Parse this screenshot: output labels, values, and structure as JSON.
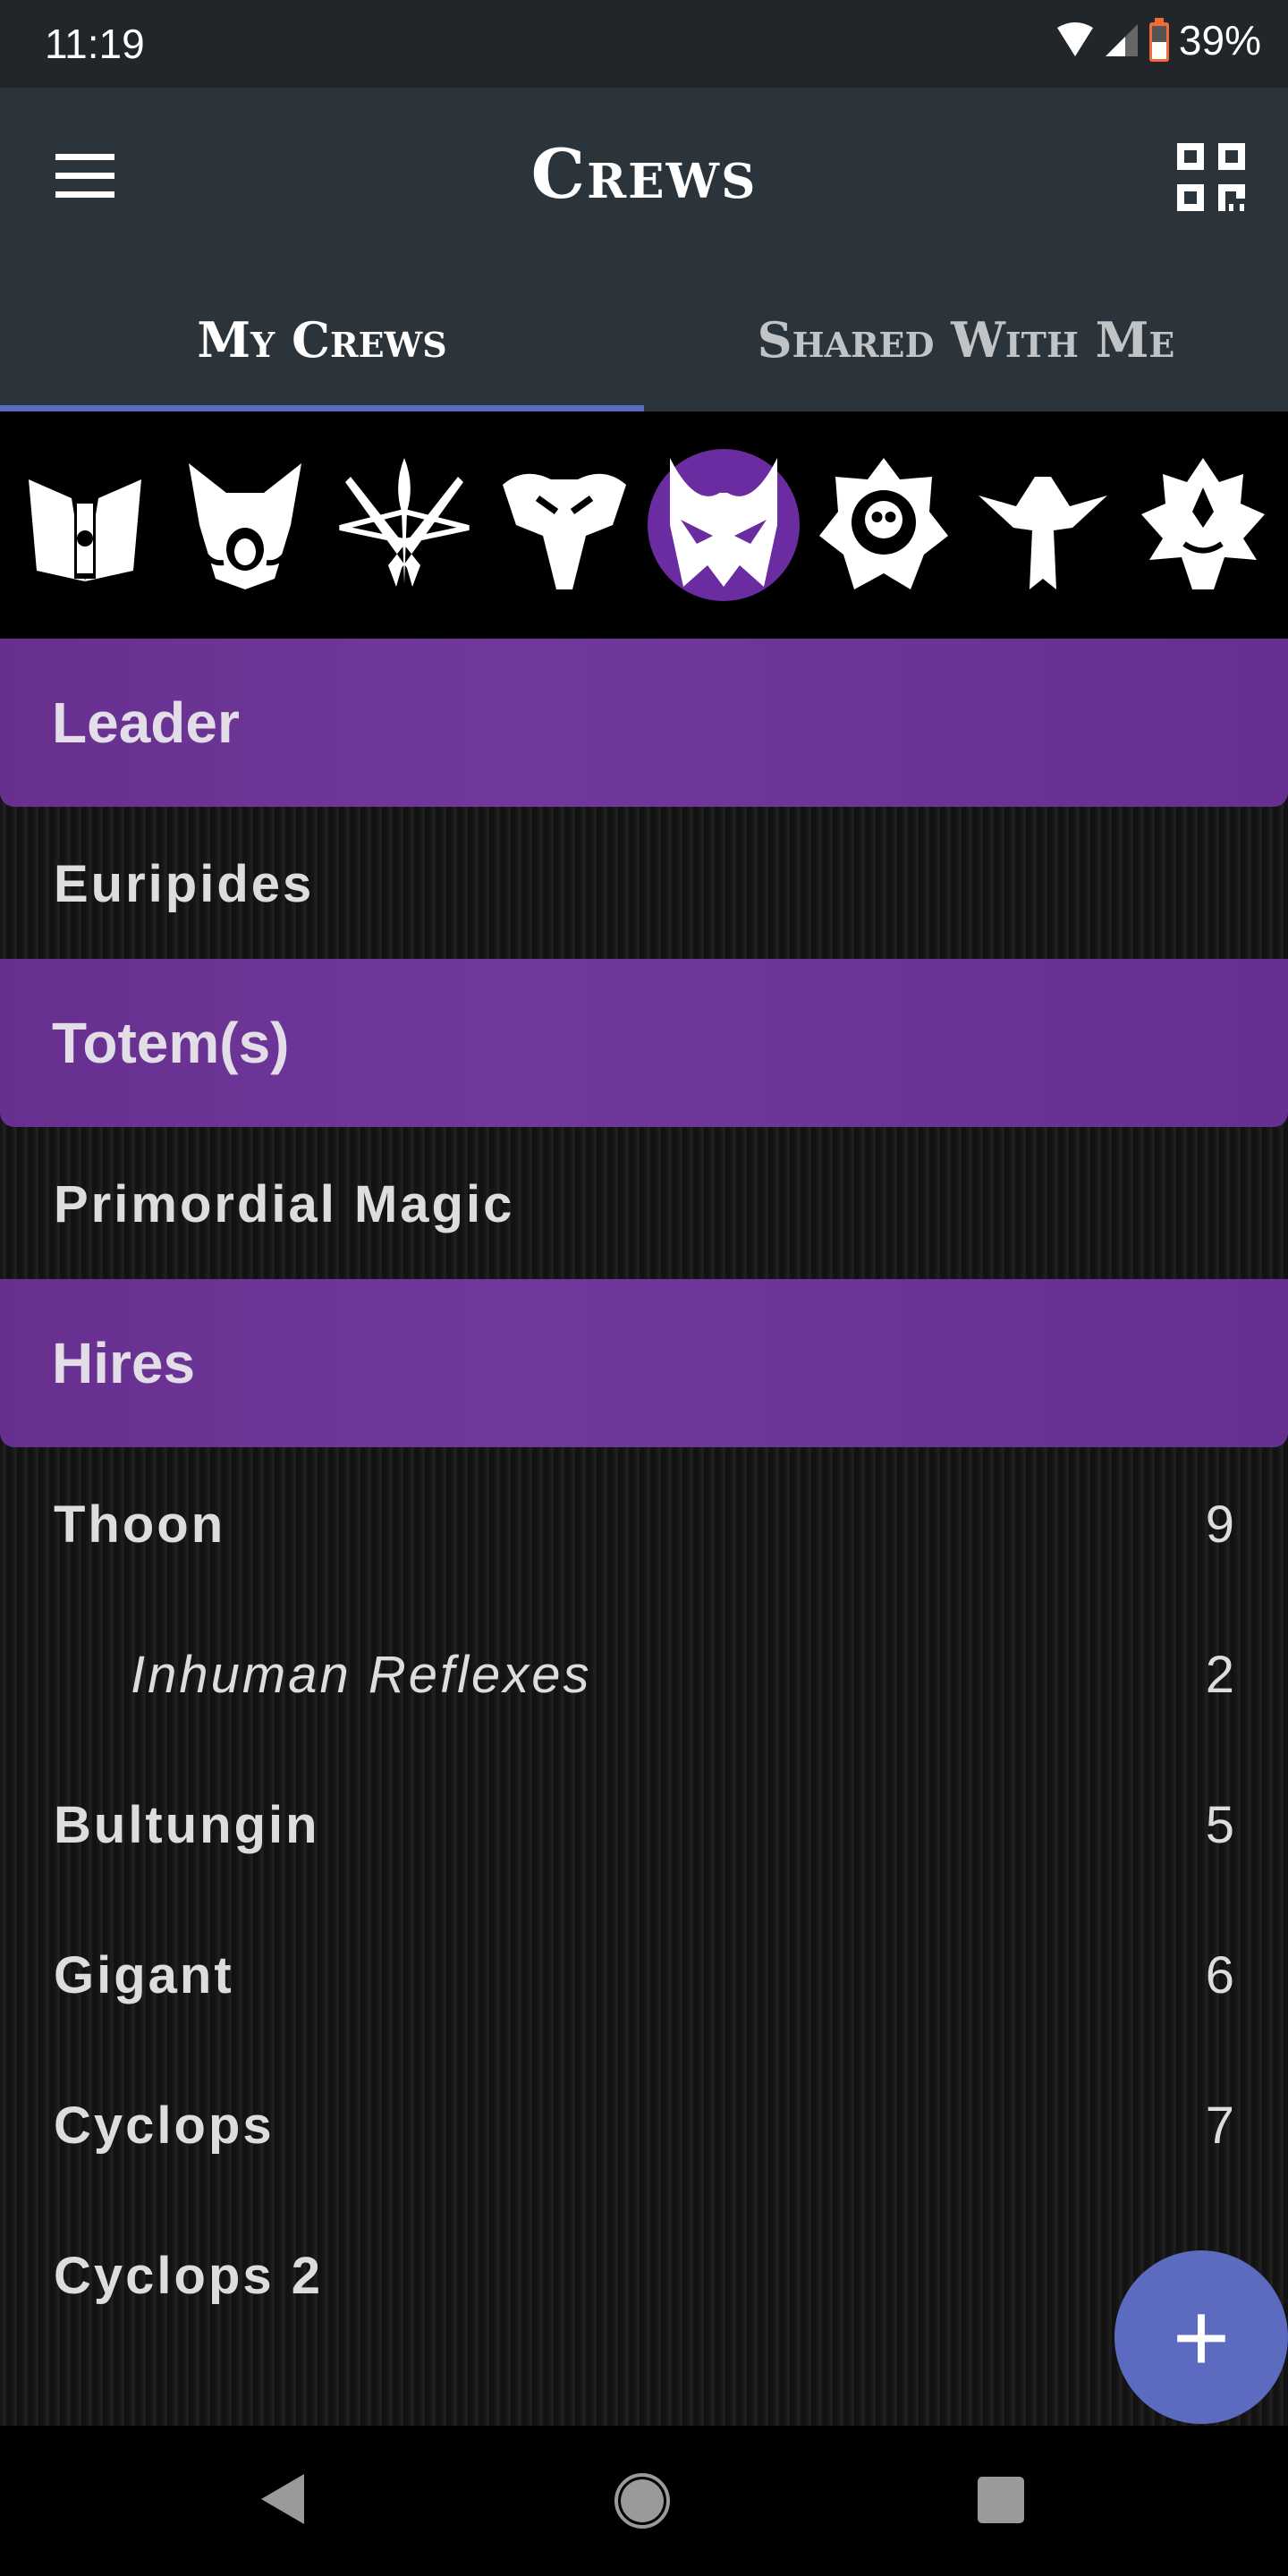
{
  "status_bar": {
    "time": "11:19",
    "battery": "39%",
    "icons": [
      "wifi-icon",
      "signal-icon",
      "battery-charging-icon"
    ],
    "battery_color": "#f26b3a"
  },
  "app_bar": {
    "title": "Crews",
    "menu_icon": "hamburger-menu-icon",
    "action_icon": "qr-code-icon"
  },
  "tabs": [
    {
      "label": "My Crews",
      "active": true
    },
    {
      "label": "Shared With Me",
      "active": false
    }
  ],
  "accent_color": "#5c6bc0",
  "section_color": "#6a2ca0",
  "factions": {
    "icons": [
      "book-emblem-icon",
      "boar-emblem-icon",
      "crossed-pistols-emblem-icon",
      "bull-skull-emblem-icon",
      "mask-emblem-icon",
      "skull-rose-emblem-icon",
      "phoenix-emblem-icon",
      "dragon-emblem-icon"
    ],
    "selected_index": 4
  },
  "sections": {
    "leader": {
      "label": "Leader",
      "items": [
        {
          "name": "Euripides"
        }
      ]
    },
    "totems": {
      "label": "Totem(s)",
      "items": [
        {
          "name": "Primordial Magic"
        }
      ]
    },
    "hires": {
      "label": "Hires",
      "items": [
        {
          "name": "Thoon",
          "cost": "9"
        },
        {
          "name": "Inhuman Reflexes",
          "cost": "2",
          "upgrade": true
        },
        {
          "name": "Bultungin",
          "cost": "5"
        },
        {
          "name": "Gigant",
          "cost": "6"
        },
        {
          "name": "Cyclops",
          "cost": "7"
        },
        {
          "name": "Cyclops 2",
          "cost": ""
        }
      ]
    }
  },
  "fab": {
    "icon": "plus-icon",
    "label": "+"
  },
  "nav_bar": {
    "icons": [
      "back-icon",
      "home-icon",
      "recents-icon"
    ]
  }
}
